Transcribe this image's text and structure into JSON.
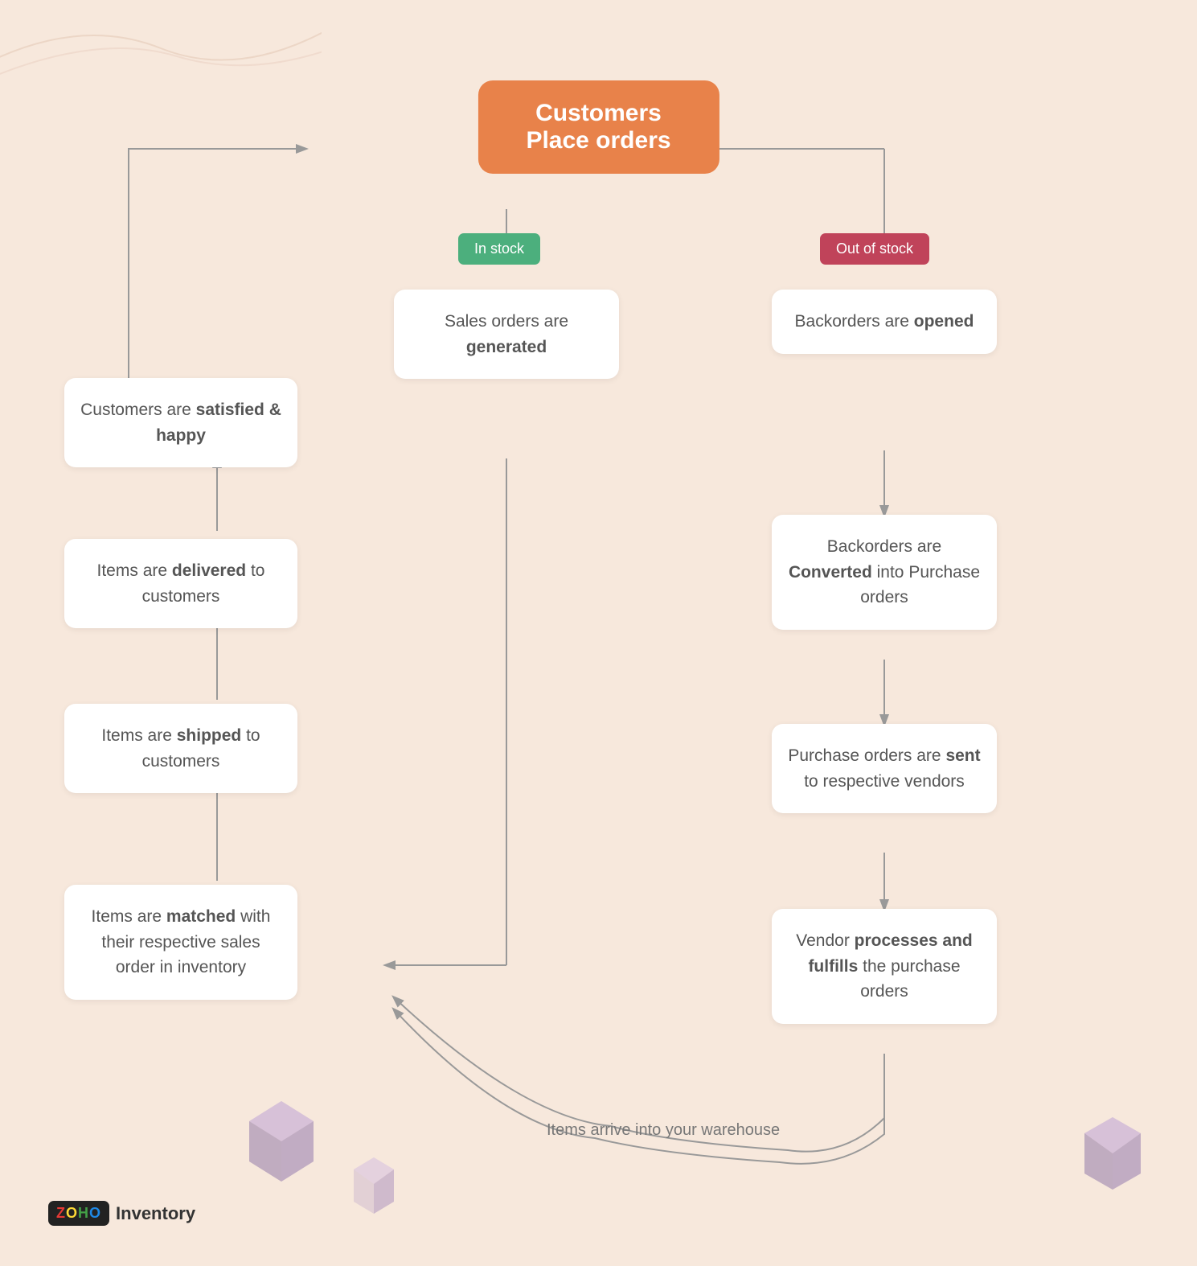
{
  "diagram": {
    "background_color": "#f7e8dc",
    "top_node": {
      "text_line1": "Customers",
      "text_line2": "Place orders",
      "bg_color": "#e8824a"
    },
    "badge_instock": {
      "label": "In stock",
      "color": "#4caf7d"
    },
    "badge_outofstock": {
      "label": "Out of stock",
      "color": "#c0435a"
    },
    "left_column": [
      {
        "id": "satisfied",
        "text_plain": "Customers are ",
        "text_bold": "satisfied & happy",
        "full": "Customers are satisfied & happy"
      },
      {
        "id": "delivered",
        "text_plain": "Items are ",
        "text_bold": "delivered",
        "text_plain2": " to customers",
        "full": "Items are delivered to customers"
      },
      {
        "id": "shipped",
        "text_plain": "Items are ",
        "text_bold": "shipped",
        "text_plain2": " to customers",
        "full": "Items are shipped to customers"
      },
      {
        "id": "matched",
        "text_plain": "Items are ",
        "text_bold": "matched",
        "text_plain2": " with their respective sales order in inventory",
        "full": "Items are matched with their respective sales order in inventory"
      }
    ],
    "center_column": [
      {
        "id": "sales-orders",
        "text_plain": "Sales orders are ",
        "text_bold": "generated",
        "full": "Sales orders are generated"
      }
    ],
    "right_column": [
      {
        "id": "backorders-opened",
        "text_plain": "Backorders are ",
        "text_bold": "opened",
        "full": "Backorders are opened"
      },
      {
        "id": "backorders-converted",
        "text_plain": "Backorders are ",
        "text_bold": "Converted",
        "text_plain2": " into Purchase orders",
        "full": "Backorders are Converted into Purchase orders"
      },
      {
        "id": "purchase-orders-sent",
        "text_plain": "Purchase orders are ",
        "text_bold": "sent",
        "text_plain2": " to respective vendors",
        "full": "Purchase orders are sent to respective vendors"
      },
      {
        "id": "vendor-processes",
        "text_plain": "Vendor ",
        "text_bold": "processes and fulfills",
        "text_plain2": " the purchase orders",
        "full": "Vendor processes and fulfills the purchase orders"
      }
    ],
    "bottom_label": {
      "text": "Items arrive into your warehouse",
      "full": "Items arrive into your warehouse"
    },
    "logo": {
      "zoho_text": "ZOHO",
      "product": "Inventory"
    }
  }
}
